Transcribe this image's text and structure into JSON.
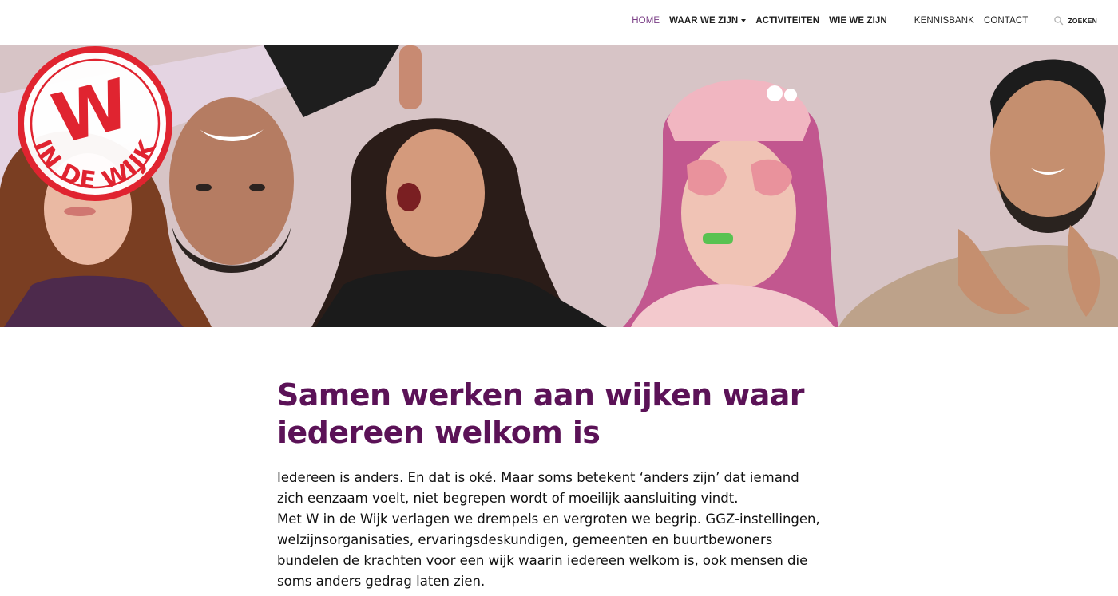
{
  "brand": {
    "logo_text_big": "W",
    "logo_text_ring": "IN DE WIJK",
    "stamp_color": "#e02430"
  },
  "nav": {
    "items": [
      {
        "label": "HOME",
        "active": true
      },
      {
        "label": "WAAR WE ZIJN",
        "has_dropdown": true
      },
      {
        "label": "ACTIVITEITEN"
      },
      {
        "label": "WIE WE ZIJN"
      },
      {
        "label": "KENNISBANK"
      },
      {
        "label": "CONTACT"
      }
    ],
    "search_label": "ZOEKEN"
  },
  "hero": {
    "background_color": "#d7c4c6",
    "image": "photo-banner-five-people"
  },
  "main": {
    "title_line1": "Samen werken aan wijken waar",
    "title_line2": "iedereen welkom is",
    "paragraph1_line1": "Iedereen is anders. En dat is oké. Maar soms betekent ‘anders zijn’ dat iemand",
    "paragraph1_line2": "zich eenzaam voelt, niet begrepen wordt of moeilijk aansluiting vindt.",
    "paragraph2_line1": "Met W in de Wijk verlagen we drempels en vergroten we begrip. GGZ-instellingen,",
    "paragraph2_line2": "welzijnsorganisaties, ervaringsdeskundigen, gemeenten en buurtbewoners",
    "paragraph2_line3": "bundelen de krachten voor een wijk waarin iedereen welkom is, ook mensen die",
    "paragraph2_line4": "soms anders gedrag laten zien."
  },
  "colors": {
    "accent": "#5b1257",
    "nav_active": "#7a3e86"
  }
}
